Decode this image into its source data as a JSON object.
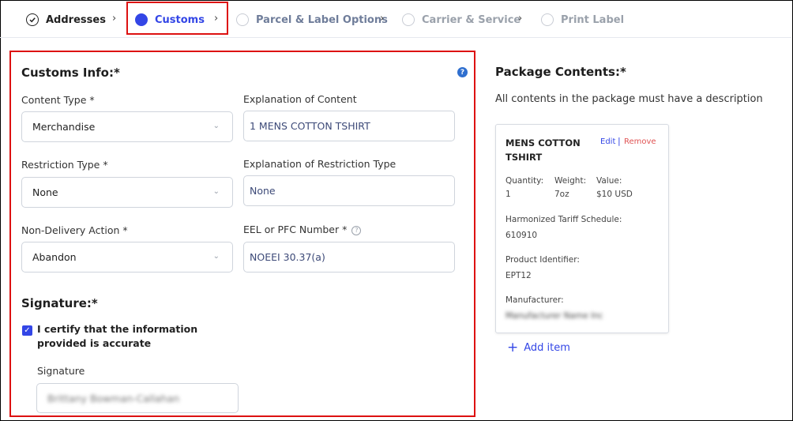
{
  "stepper": {
    "steps": [
      {
        "label": "Addresses",
        "state": "done"
      },
      {
        "label": "Customs",
        "state": "current"
      },
      {
        "label": "Parcel & Label Options",
        "state": "todo"
      },
      {
        "label": "Carrier & Service",
        "state": "todo"
      },
      {
        "label": "Print Label",
        "state": "todo"
      }
    ]
  },
  "customs": {
    "title": "Customs Info:*",
    "content_type": {
      "label": "Content Type *",
      "value": "Merchandise"
    },
    "explanation_content": {
      "label": "Explanation of Content",
      "value": "1 MENS COTTON TSHIRT"
    },
    "restriction_type": {
      "label": "Restriction Type *",
      "value": "None"
    },
    "explanation_restriction": {
      "label": "Explanation of Restriction Type",
      "value": "None"
    },
    "non_delivery": {
      "label": "Non-Delivery Action *",
      "value": "Abandon"
    },
    "eel": {
      "label": "EEL or PFC Number *",
      "value": "NOEEI 30.37(a)"
    }
  },
  "signature": {
    "title": "Signature:*",
    "certify": "I certify that the information provided is accurate",
    "field_label": "Signature",
    "value": "Brittany Bowman-Callahan"
  },
  "package": {
    "title": "Package Contents:*",
    "desc": "All contents in the package must have a description",
    "item": {
      "name": "MENS COTTON TSHIRT",
      "edit": "Edit",
      "sep": "|",
      "remove": "Remove",
      "quantity_label": "Quantity:",
      "quantity": "1",
      "weight_label": "Weight:",
      "weight": "7oz",
      "value_label": "Value:",
      "value": "$10 USD",
      "hts_label": "Harmonized Tariff Schedule:",
      "hts": "610910",
      "pid_label": "Product Identifier:",
      "pid": "EPT12",
      "mfr_label": "Manufacturer:",
      "mfr": "Manufacturer Name Inc"
    },
    "add_item": "Add item"
  },
  "colors": {
    "accent": "#3346e6",
    "highlight": "#dd1111",
    "remove": "#e05454"
  },
  "icons": {
    "check": "check-icon",
    "chevron": "chevron-right-icon",
    "help": "help-icon",
    "plus": "plus-icon"
  }
}
